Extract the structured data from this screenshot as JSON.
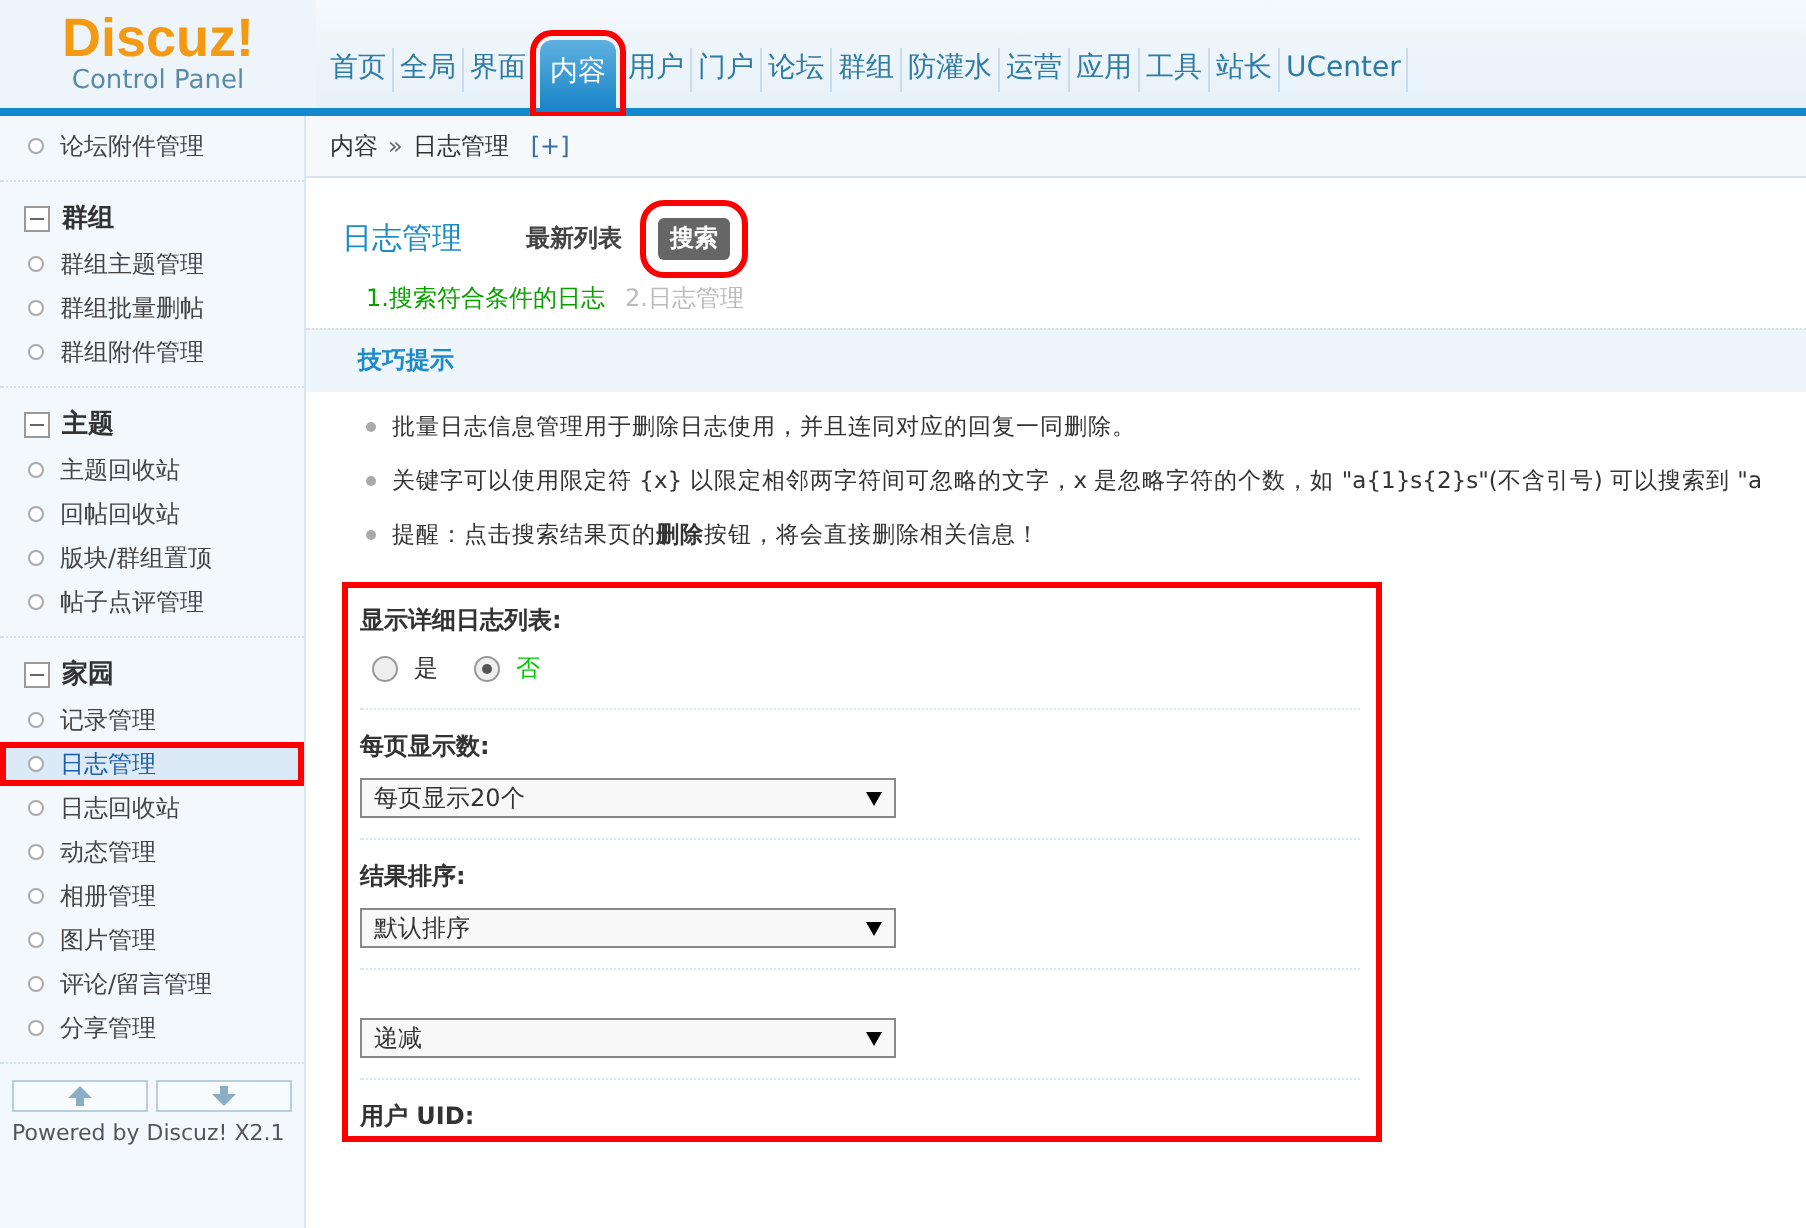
{
  "logo": {
    "name": "Discuz!",
    "subtitle": "Control Panel"
  },
  "nav": [
    {
      "label": "首页",
      "selected": false
    },
    {
      "label": "全局",
      "selected": false
    },
    {
      "label": "界面",
      "selected": false
    },
    {
      "label": "内容",
      "selected": true
    },
    {
      "label": "用户",
      "selected": false
    },
    {
      "label": "门户",
      "selected": false
    },
    {
      "label": "论坛",
      "selected": false
    },
    {
      "label": "群组",
      "selected": false
    },
    {
      "label": "防灌水",
      "selected": false
    },
    {
      "label": "运营",
      "selected": false
    },
    {
      "label": "应用",
      "selected": false
    },
    {
      "label": "工具",
      "selected": false
    },
    {
      "label": "站长",
      "selected": false
    },
    {
      "label": "UCenter",
      "selected": false
    }
  ],
  "breadcrumb": {
    "items": [
      "内容",
      "日志管理"
    ],
    "separator": "»",
    "add": "[+]"
  },
  "sidebar": {
    "groups": [
      {
        "items": [
          {
            "label": "论坛附件管理",
            "selected": false
          }
        ]
      },
      {
        "title": "群组",
        "expanded": true,
        "items": [
          {
            "label": "群组主题管理",
            "selected": false
          },
          {
            "label": "群组批量删帖",
            "selected": false
          },
          {
            "label": "群组附件管理",
            "selected": false
          }
        ]
      },
      {
        "title": "主题",
        "expanded": true,
        "items": [
          {
            "label": "主题回收站",
            "selected": false
          },
          {
            "label": "回帖回收站",
            "selected": false
          },
          {
            "label": "版块/群组置顶",
            "selected": false
          },
          {
            "label": "帖子点评管理",
            "selected": false
          }
        ]
      },
      {
        "title": "家园",
        "expanded": true,
        "items": [
          {
            "label": "记录管理",
            "selected": false
          },
          {
            "label": "日志管理",
            "selected": true
          },
          {
            "label": "日志回收站",
            "selected": false
          },
          {
            "label": "动态管理",
            "selected": false
          },
          {
            "label": "相册管理",
            "selected": false
          },
          {
            "label": "图片管理",
            "selected": false
          },
          {
            "label": "评论/留言管理",
            "selected": false
          },
          {
            "label": "分享管理",
            "selected": false
          }
        ]
      }
    ],
    "footer": "Powered by Discuz! X2.1"
  },
  "page": {
    "title": "日志管理",
    "tabs": [
      {
        "label": "最新列表",
        "selected": false
      },
      {
        "label": "搜索",
        "selected": true
      }
    ],
    "steps": [
      {
        "label": "1.搜索符合条件的日志",
        "current": true
      },
      {
        "label": "2.日志管理",
        "current": false
      }
    ],
    "tips": {
      "title": "技巧提示",
      "items": [
        "批量日志信息管理用于删除日志使用，并且连同对应的回复一同删除。",
        "关键字可以使用限定符 {x} 以限定相邻两字符间可忽略的文字，x 是忽略字符的个数，如 \"a{1}s{2}s\"(不含引号) 可以搜索到 \"a",
        "提醒：点击搜索结果页的**删除**按钮，将会直接删除相关信息！"
      ]
    },
    "form": [
      {
        "kind": "radio",
        "label": "显示详细日志列表:",
        "options": [
          {
            "label": "是",
            "selected": false
          },
          {
            "label": "否",
            "selected": true
          }
        ]
      },
      {
        "kind": "select",
        "label": "每页显示数:",
        "value": "每页显示20个"
      },
      {
        "kind": "select",
        "label": "结果排序:",
        "value": "默认排序"
      },
      {
        "kind": "select",
        "value": "递减"
      },
      {
        "kind": "heading",
        "label": "用户 UID:"
      }
    ]
  }
}
